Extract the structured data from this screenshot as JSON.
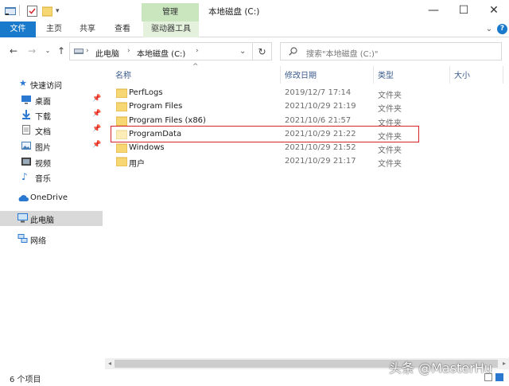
{
  "window": {
    "title": "本地磁盘 (C:)",
    "context_tab": "管理",
    "controls": {
      "minimize": "—",
      "maximize": "☐",
      "close": "✕"
    }
  },
  "ribbon": {
    "tabs": [
      {
        "label": "文件"
      },
      {
        "label": "主页"
      },
      {
        "label": "共享"
      },
      {
        "label": "查看"
      },
      {
        "label": "驱动器工具"
      }
    ],
    "help": "?"
  },
  "address": {
    "crumbs": [
      "此电脑",
      "本地磁盘 (C:)"
    ],
    "search_placeholder": "搜索\"本地磁盘 (C:)\""
  },
  "nav_pane": {
    "quick_access": "快速访问",
    "items": [
      {
        "label": "桌面",
        "icon": "desktop-icon",
        "pinned": true
      },
      {
        "label": "下载",
        "icon": "download-icon",
        "pinned": true
      },
      {
        "label": "文档",
        "icon": "documents-icon",
        "pinned": true
      },
      {
        "label": "图片",
        "icon": "pictures-icon",
        "pinned": true
      },
      {
        "label": "视频",
        "icon": "videos-icon",
        "pinned": false
      },
      {
        "label": "音乐",
        "icon": "music-icon",
        "pinned": false
      }
    ],
    "onedrive": "OneDrive",
    "this_pc": "此电脑",
    "network": "网络"
  },
  "columns": {
    "name": "名称",
    "date": "修改日期",
    "type": "类型",
    "size": "大小"
  },
  "files": [
    {
      "name": "PerfLogs",
      "date": "2019/12/7 17:14",
      "type": "文件夹"
    },
    {
      "name": "Program Files",
      "date": "2021/10/29 21:19",
      "type": "文件夹"
    },
    {
      "name": "Program Files (x86)",
      "date": "2021/10/6 21:57",
      "type": "文件夹"
    },
    {
      "name": "ProgramData",
      "date": "2021/10/29 21:22",
      "type": "文件夹",
      "hidden": true,
      "highlighted": true
    },
    {
      "name": "Windows",
      "date": "2021/10/29 21:52",
      "type": "文件夹"
    },
    {
      "name": "用户",
      "date": "2021/10/29 21:17",
      "type": "文件夹"
    }
  ],
  "status": {
    "item_count": "6 个项目"
  },
  "watermark": "头条 @MasterHu",
  "colors": {
    "accent": "#1979ca",
    "context_tab": "#c9e6bf",
    "highlight_box": "#d9232a",
    "folder": "#f7d774"
  }
}
